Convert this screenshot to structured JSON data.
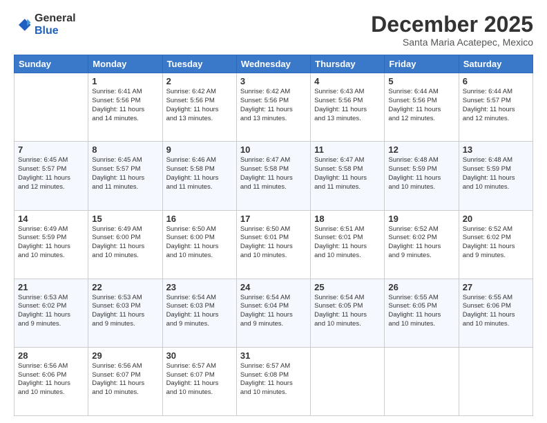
{
  "logo": {
    "general": "General",
    "blue": "Blue"
  },
  "header": {
    "title": "December 2025",
    "subtitle": "Santa Maria Acatepec, Mexico"
  },
  "days_of_week": [
    "Sunday",
    "Monday",
    "Tuesday",
    "Wednesday",
    "Thursday",
    "Friday",
    "Saturday"
  ],
  "weeks": [
    [
      {
        "day": "",
        "detail": ""
      },
      {
        "day": "1",
        "detail": "Sunrise: 6:41 AM\nSunset: 5:56 PM\nDaylight: 11 hours\nand 14 minutes."
      },
      {
        "day": "2",
        "detail": "Sunrise: 6:42 AM\nSunset: 5:56 PM\nDaylight: 11 hours\nand 13 minutes."
      },
      {
        "day": "3",
        "detail": "Sunrise: 6:42 AM\nSunset: 5:56 PM\nDaylight: 11 hours\nand 13 minutes."
      },
      {
        "day": "4",
        "detail": "Sunrise: 6:43 AM\nSunset: 5:56 PM\nDaylight: 11 hours\nand 13 minutes."
      },
      {
        "day": "5",
        "detail": "Sunrise: 6:44 AM\nSunset: 5:56 PM\nDaylight: 11 hours\nand 12 minutes."
      },
      {
        "day": "6",
        "detail": "Sunrise: 6:44 AM\nSunset: 5:57 PM\nDaylight: 11 hours\nand 12 minutes."
      }
    ],
    [
      {
        "day": "7",
        "detail": "Sunrise: 6:45 AM\nSunset: 5:57 PM\nDaylight: 11 hours\nand 12 minutes."
      },
      {
        "day": "8",
        "detail": "Sunrise: 6:45 AM\nSunset: 5:57 PM\nDaylight: 11 hours\nand 11 minutes."
      },
      {
        "day": "9",
        "detail": "Sunrise: 6:46 AM\nSunset: 5:58 PM\nDaylight: 11 hours\nand 11 minutes."
      },
      {
        "day": "10",
        "detail": "Sunrise: 6:47 AM\nSunset: 5:58 PM\nDaylight: 11 hours\nand 11 minutes."
      },
      {
        "day": "11",
        "detail": "Sunrise: 6:47 AM\nSunset: 5:58 PM\nDaylight: 11 hours\nand 11 minutes."
      },
      {
        "day": "12",
        "detail": "Sunrise: 6:48 AM\nSunset: 5:59 PM\nDaylight: 11 hours\nand 10 minutes."
      },
      {
        "day": "13",
        "detail": "Sunrise: 6:48 AM\nSunset: 5:59 PM\nDaylight: 11 hours\nand 10 minutes."
      }
    ],
    [
      {
        "day": "14",
        "detail": "Sunrise: 6:49 AM\nSunset: 5:59 PM\nDaylight: 11 hours\nand 10 minutes."
      },
      {
        "day": "15",
        "detail": "Sunrise: 6:49 AM\nSunset: 6:00 PM\nDaylight: 11 hours\nand 10 minutes."
      },
      {
        "day": "16",
        "detail": "Sunrise: 6:50 AM\nSunset: 6:00 PM\nDaylight: 11 hours\nand 10 minutes."
      },
      {
        "day": "17",
        "detail": "Sunrise: 6:50 AM\nSunset: 6:01 PM\nDaylight: 11 hours\nand 10 minutes."
      },
      {
        "day": "18",
        "detail": "Sunrise: 6:51 AM\nSunset: 6:01 PM\nDaylight: 11 hours\nand 10 minutes."
      },
      {
        "day": "19",
        "detail": "Sunrise: 6:52 AM\nSunset: 6:02 PM\nDaylight: 11 hours\nand 9 minutes."
      },
      {
        "day": "20",
        "detail": "Sunrise: 6:52 AM\nSunset: 6:02 PM\nDaylight: 11 hours\nand 9 minutes."
      }
    ],
    [
      {
        "day": "21",
        "detail": "Sunrise: 6:53 AM\nSunset: 6:02 PM\nDaylight: 11 hours\nand 9 minutes."
      },
      {
        "day": "22",
        "detail": "Sunrise: 6:53 AM\nSunset: 6:03 PM\nDaylight: 11 hours\nand 9 minutes."
      },
      {
        "day": "23",
        "detail": "Sunrise: 6:54 AM\nSunset: 6:03 PM\nDaylight: 11 hours\nand 9 minutes."
      },
      {
        "day": "24",
        "detail": "Sunrise: 6:54 AM\nSunset: 6:04 PM\nDaylight: 11 hours\nand 9 minutes."
      },
      {
        "day": "25",
        "detail": "Sunrise: 6:54 AM\nSunset: 6:05 PM\nDaylight: 11 hours\nand 10 minutes."
      },
      {
        "day": "26",
        "detail": "Sunrise: 6:55 AM\nSunset: 6:05 PM\nDaylight: 11 hours\nand 10 minutes."
      },
      {
        "day": "27",
        "detail": "Sunrise: 6:55 AM\nSunset: 6:06 PM\nDaylight: 11 hours\nand 10 minutes."
      }
    ],
    [
      {
        "day": "28",
        "detail": "Sunrise: 6:56 AM\nSunset: 6:06 PM\nDaylight: 11 hours\nand 10 minutes."
      },
      {
        "day": "29",
        "detail": "Sunrise: 6:56 AM\nSunset: 6:07 PM\nDaylight: 11 hours\nand 10 minutes."
      },
      {
        "day": "30",
        "detail": "Sunrise: 6:57 AM\nSunset: 6:07 PM\nDaylight: 11 hours\nand 10 minutes."
      },
      {
        "day": "31",
        "detail": "Sunrise: 6:57 AM\nSunset: 6:08 PM\nDaylight: 11 hours\nand 10 minutes."
      },
      {
        "day": "",
        "detail": ""
      },
      {
        "day": "",
        "detail": ""
      },
      {
        "day": "",
        "detail": ""
      }
    ]
  ]
}
